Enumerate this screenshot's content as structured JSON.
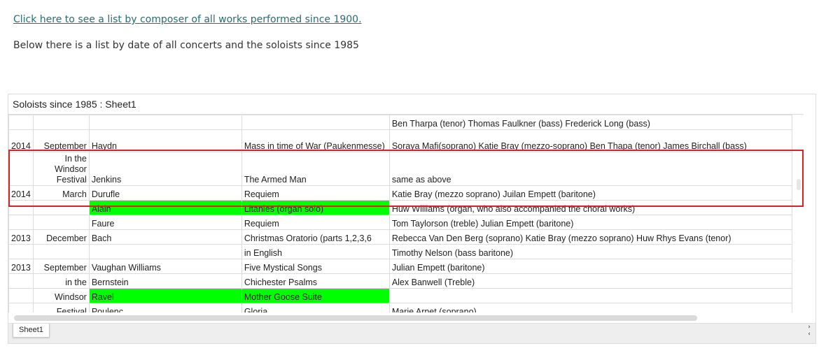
{
  "intro": {
    "link_text": "Click here to see a list by composer of all works performed since 1900.",
    "description": "Below there is a list by date of all concerts and the soloists since 1985"
  },
  "sheet": {
    "title": "Soloists since 1985 : Sheet1",
    "tab_label": "Sheet1",
    "nav_next": "›",
    "nav_prev": "‹",
    "colors": {
      "highlight_border": "#e02020",
      "cell_green": "#00ff00"
    }
  },
  "rows": [
    {
      "year": "",
      "month": "",
      "composer": "",
      "work": "",
      "soloists": "Ben Tharpa (tenor) Thomas Faulkner (bass) Frederick Long (bass)",
      "green": false
    },
    {
      "year": "2014",
      "month": "September",
      "composer": "Haydn",
      "work": "Mass in time of War (Paukenmesse)",
      "soloists": "Soraya Mafi(soprano) Katie Bray (mezzo-soprano) Ben Thapa (tenor) James Birchall (bass)",
      "green": false
    },
    {
      "year": "",
      "month": "In the Windsor Festival",
      "composer": "Jenkins",
      "work": "The Armed Man",
      "soloists": "same as above",
      "green": false
    },
    {
      "year": "2014",
      "month": "March",
      "composer": "Durufle",
      "work": "Requiem",
      "soloists": "Katie Bray (mezzo soprano) Juilan Empett (baritone)",
      "green": false
    },
    {
      "year": "",
      "month": "",
      "composer": "Alain",
      "work": "Litanies (organ solo)",
      "soloists": "Huw Williams (organ, who also accompanied the choral works)",
      "green": true
    },
    {
      "year": "",
      "month": "",
      "composer": "Faure",
      "work": "Requiem",
      "soloists": "Tom Taylorson (treble) Julian Empett (baritone)",
      "green": false
    },
    {
      "year": "2013",
      "month": "December",
      "composer": "Bach",
      "work": "Christmas Oratorio (parts 1,2,3,6",
      "soloists": "Rebecca Van Den Berg (soprano) Katie Bray (mezzo soprano) Huw Rhys Evans (tenor)",
      "green": false
    },
    {
      "year": "",
      "month": "",
      "composer": "",
      "work": "in English",
      "soloists": "Timothy Nelson (bass baritone)",
      "green": false
    },
    {
      "year": "2013",
      "month": "September",
      "composer": "Vaughan Williams",
      "work": "Five Mystical Songs",
      "soloists": "Julian Empett (baritone)",
      "green": false
    },
    {
      "year": "",
      "month": "in the",
      "composer": "Bernstein",
      "work": "Chichester Psalms",
      "soloists": "Alex Banwell (Treble)",
      "green": false
    },
    {
      "year": "",
      "month": "Windsor",
      "composer": "Ravel",
      "work": "Mother Goose Suite",
      "soloists": "",
      "green": true
    },
    {
      "year": "",
      "month": "Festival",
      "composer": "Poulenc",
      "work": "Gloria",
      "soloists": "Marie Arnet (soprano)",
      "green": false
    }
  ]
}
